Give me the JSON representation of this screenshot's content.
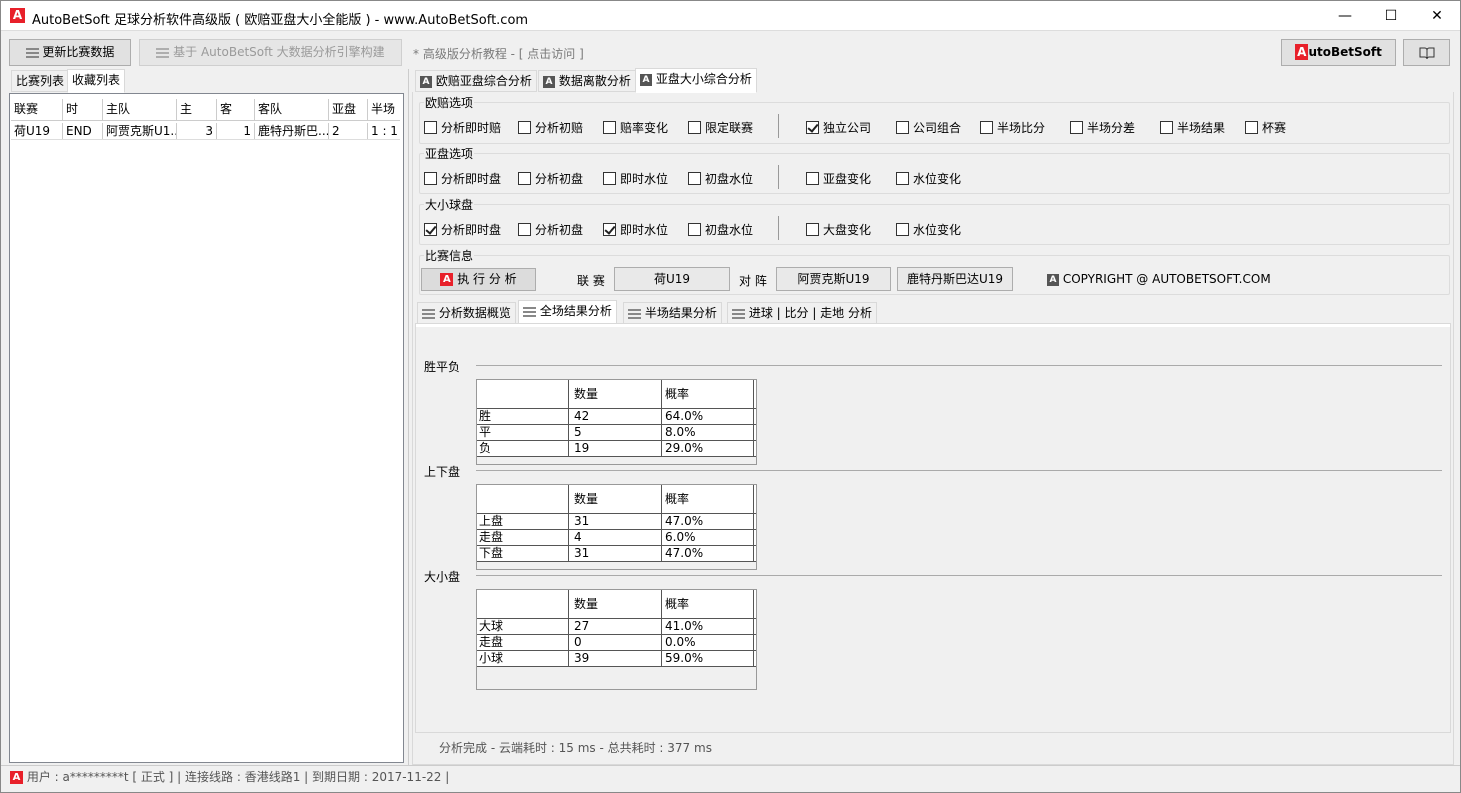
{
  "window": {
    "title": "AutoBetSoft 足球分析软件高级版 ( 欧赔亚盘大小全能版 ) -  www.AutoBetSoft.com",
    "minimize": "—",
    "maximize": "☐",
    "close": "✕"
  },
  "toolbar": {
    "update_label": "更新比赛数据",
    "engine_label": "基于 AutoBetSoft 大数据分析引擎构建",
    "tutorial_link": "* 高级版分析教程 - [ 点击访问 ]",
    "brand_a": "A",
    "brand_rest": "utoBetSoft",
    "book_icon": "book-icon"
  },
  "left_tabs": [
    "比赛列表",
    "收藏列表"
  ],
  "match_table": {
    "headers": [
      "联赛",
      "时",
      "主队",
      "主",
      "客",
      "客队",
      "亚盘",
      "半场"
    ],
    "rows": [
      [
        "荷U19",
        "END",
        "阿贾克斯U1...",
        "3",
        "1",
        "鹿特丹斯巴...",
        "2",
        "1 : 1"
      ]
    ]
  },
  "main_tabs": [
    "欧赔亚盘综合分析",
    "数据离散分析",
    "亚盘大小综合分析"
  ],
  "europe": {
    "label": "欧赔选项",
    "options": [
      "分析即时赔",
      "分析初赔",
      "赔率变化",
      "限定联赛",
      "独立公司",
      "公司组合",
      "半场比分",
      "半场分差",
      "半场结果",
      "杯赛"
    ]
  },
  "asian": {
    "label": "亚盘选项",
    "options": [
      "分析即时盘",
      "分析初盘",
      "即时水位",
      "初盘水位",
      "亚盘变化",
      "水位变化"
    ]
  },
  "overunder": {
    "label": "大小球盘",
    "options": [
      "分析即时盘",
      "分析初盘",
      "即时水位",
      "初盘水位",
      "大盘变化",
      "水位变化"
    ]
  },
  "match_info": {
    "label": "比赛信息",
    "exec_label": "执 行 分 析",
    "league_label": "联 赛",
    "league": "荷U19",
    "vs_label": "对 阵",
    "home": "阿贾克斯U19",
    "away": "鹿特丹斯巴达U19",
    "copyright": "COPYRIGHT @ AUTOBETSOFT.COM"
  },
  "sub_tabs": [
    "分析数据概览",
    "全场结果分析",
    "半场结果分析",
    "进球 | 比分 | 走地 分析"
  ],
  "sections": [
    {
      "title": "胜平负",
      "col_count": "数量",
      "col_prob": "概率",
      "rows": [
        [
          "胜",
          "42",
          "64.0%"
        ],
        [
          "平",
          "5",
          "8.0%"
        ],
        [
          "负",
          "19",
          "29.0%"
        ]
      ]
    },
    {
      "title": "上下盘",
      "col_count": "数量",
      "col_prob": "概率",
      "rows": [
        [
          "上盘",
          "31",
          "47.0%"
        ],
        [
          "走盘",
          "4",
          "6.0%"
        ],
        [
          "下盘",
          "31",
          "47.0%"
        ]
      ]
    },
    {
      "title": "大小盘",
      "col_count": "数量",
      "col_prob": "概率",
      "rows": [
        [
          "大球",
          "27",
          "41.0%"
        ],
        [
          "走盘",
          "0",
          "0.0%"
        ],
        [
          "小球",
          "39",
          "59.0%"
        ]
      ]
    }
  ],
  "status": "分析完成 -  云端耗时 : 15 ms   - 总共耗时 : 377 ms",
  "bottom": "用户 : a*********t [ 正式 ] | 连接线路 : 香港线路1 | 到期日期 : 2017-11-22   |",
  "colors": {
    "brand_red": "#e8202a"
  }
}
